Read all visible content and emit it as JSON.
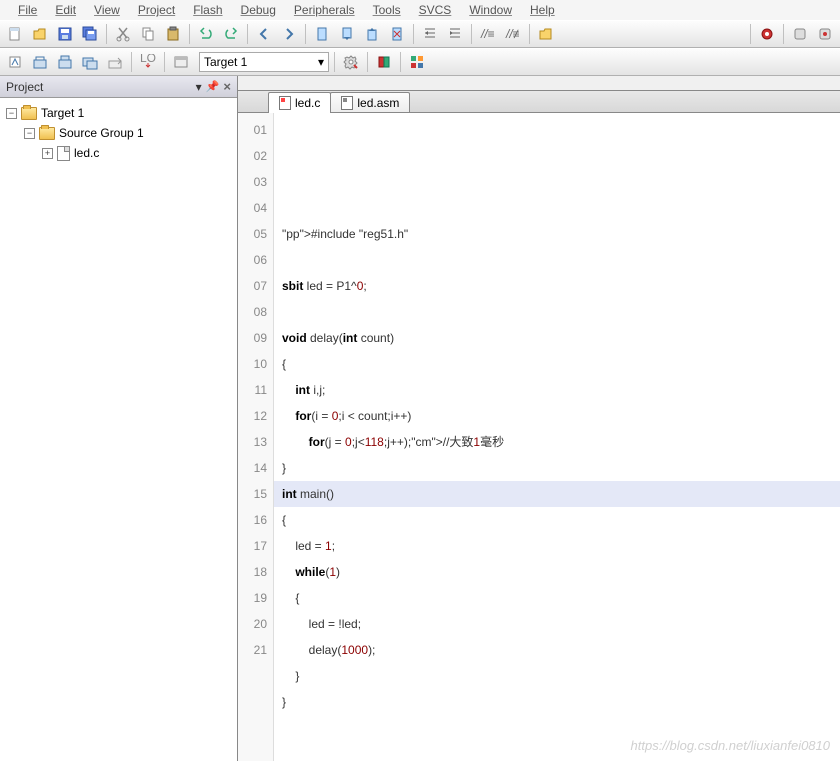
{
  "menubar": {
    "items": [
      "File",
      "Edit",
      "View",
      "Project",
      "Flash",
      "Debug",
      "Peripherals",
      "Tools",
      "SVCS",
      "Window",
      "Help"
    ]
  },
  "target_selector": {
    "value": "Target 1"
  },
  "project_panel": {
    "title": "Project",
    "tree": {
      "root": "Target 1",
      "group": "Source Group 1",
      "file": "led.c"
    }
  },
  "tabs": [
    {
      "name": "led.c",
      "kind": "c",
      "active": true
    },
    {
      "name": "led.asm",
      "kind": "asm",
      "active": false
    }
  ],
  "code": {
    "line_count": 21,
    "highlighted_line": 15,
    "lines": [
      "",
      "#include \"reg51.h\"",
      "",
      "sbit led = P1^0;",
      "",
      "void delay(int count)",
      "{",
      "    int i,j;",
      "    for(i = 0;i < count;i++)",
      "        for(j = 0;j<118;j++);//大致1毫秒",
      "}",
      "int main()",
      "{",
      "    led = 1;",
      "    while(1)",
      "    {",
      "        led = !led;",
      "        delay(1000);",
      "    }",
      "}",
      ""
    ]
  },
  "watermark": "https://blog.csdn.net/liuxianfei0810"
}
